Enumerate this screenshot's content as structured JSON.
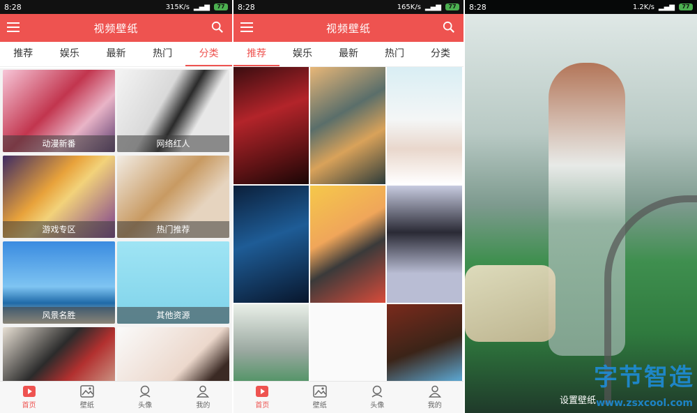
{
  "status_left": {
    "time": "8:28",
    "speed": "315K/s"
  },
  "status_mid": {
    "time": "8:28",
    "speed": "165K/s"
  },
  "status_right": {
    "time": "8:28",
    "speed": "1.2K/s"
  },
  "battery": "77",
  "app_title": "视频壁纸",
  "tabs": [
    "推荐",
    "娱乐",
    "最新",
    "热门",
    "分类"
  ],
  "categories": [
    "动漫新番",
    "网络红人",
    "游戏专区",
    "热门推荐",
    "风景名胜",
    "其他资源"
  ],
  "bottom_nav": [
    "首页",
    "壁纸",
    "头像",
    "我的"
  ],
  "preview": {
    "set_wallpaper": "设置壁纸"
  },
  "watermark": {
    "title": "字节智造",
    "url": "www.zsxcool.com"
  },
  "colors": {
    "accent": "#ee5350",
    "statusbar": "#111111",
    "watermark": "#1d8fe0"
  },
  "icons": [
    "menu-icon",
    "search-icon",
    "play-icon",
    "image-icon",
    "avatar-icon",
    "user-icon"
  ]
}
